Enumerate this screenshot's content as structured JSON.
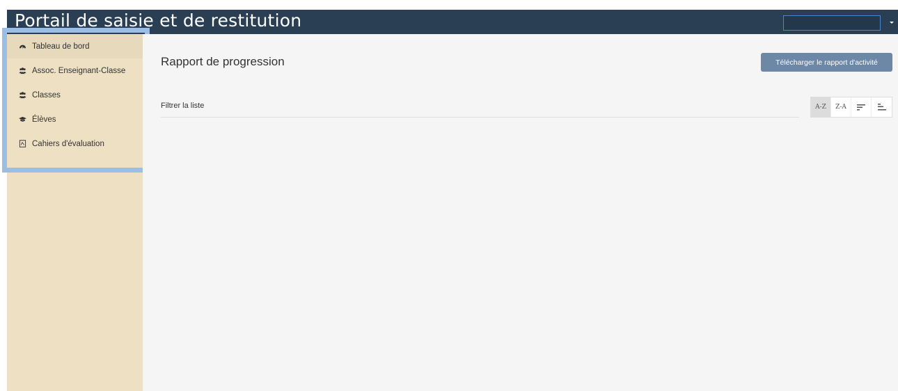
{
  "header": {
    "title": "Portail de saisie et de restitution",
    "user_box_value": ""
  },
  "sidebar": {
    "items": [
      {
        "label": "Tableau de bord",
        "icon": "dashboard-icon",
        "active": true
      },
      {
        "label": "Assoc. Enseignant-Classe",
        "icon": "users-icon",
        "active": false
      },
      {
        "label": "Classes",
        "icon": "users-icon",
        "active": false
      },
      {
        "label": "Élèves",
        "icon": "graduation-cap-icon",
        "active": false
      },
      {
        "label": "Cahiers d'évaluation",
        "icon": "file-icon",
        "active": false
      }
    ]
  },
  "main": {
    "title": "Rapport de progression",
    "download_label": "Télécharger le rapport d'activité",
    "filter_placeholder": "Filtrer la liste",
    "sort": {
      "az_label": "A-Z",
      "za_label": "Z-A",
      "desc_icon": "sort-desc-icon",
      "asc_icon": "sort-asc-icon",
      "active": "A-Z"
    }
  },
  "colors": {
    "header_bg": "#2a3f54",
    "sidebar_bg": "#ede0c3",
    "highlight_border": "#9cbde4",
    "button_bg": "#6d87a7",
    "main_bg": "#f5f5f5"
  }
}
